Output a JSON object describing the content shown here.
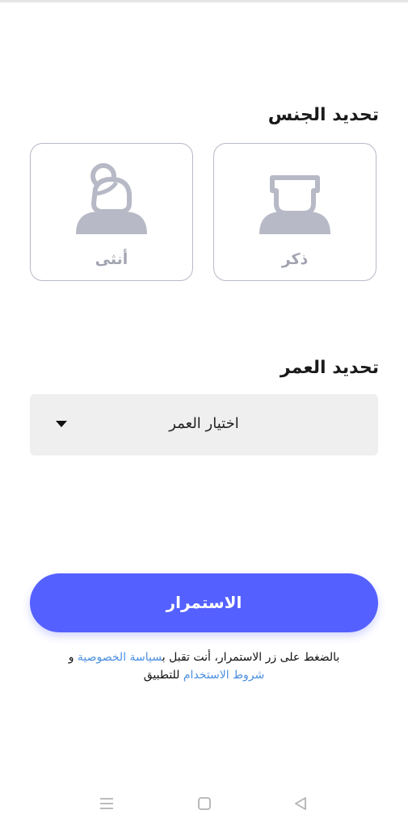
{
  "gender": {
    "title": "تحديد الجنس",
    "male_label": "ذكر",
    "female_label": "أنثى",
    "icon_color": "#b7b9c6"
  },
  "age": {
    "title": "تحديد العمر",
    "select_label": "اختيار العمر"
  },
  "continue": {
    "label": "الاستمرار",
    "color": "#5460ff"
  },
  "terms": {
    "prefix": "بالضغط على زر الاستمرار، أنت تقبل ب",
    "privacy_link": "سياسة الخصوصية",
    "and": " و",
    "terms_link": "شروط الاستخدام",
    "suffix": " للتطبيق",
    "link_color": "#4a8fe0"
  },
  "navbar": {
    "icons": [
      "menu-icon",
      "home-square-icon",
      "back-triangle-icon"
    ]
  }
}
